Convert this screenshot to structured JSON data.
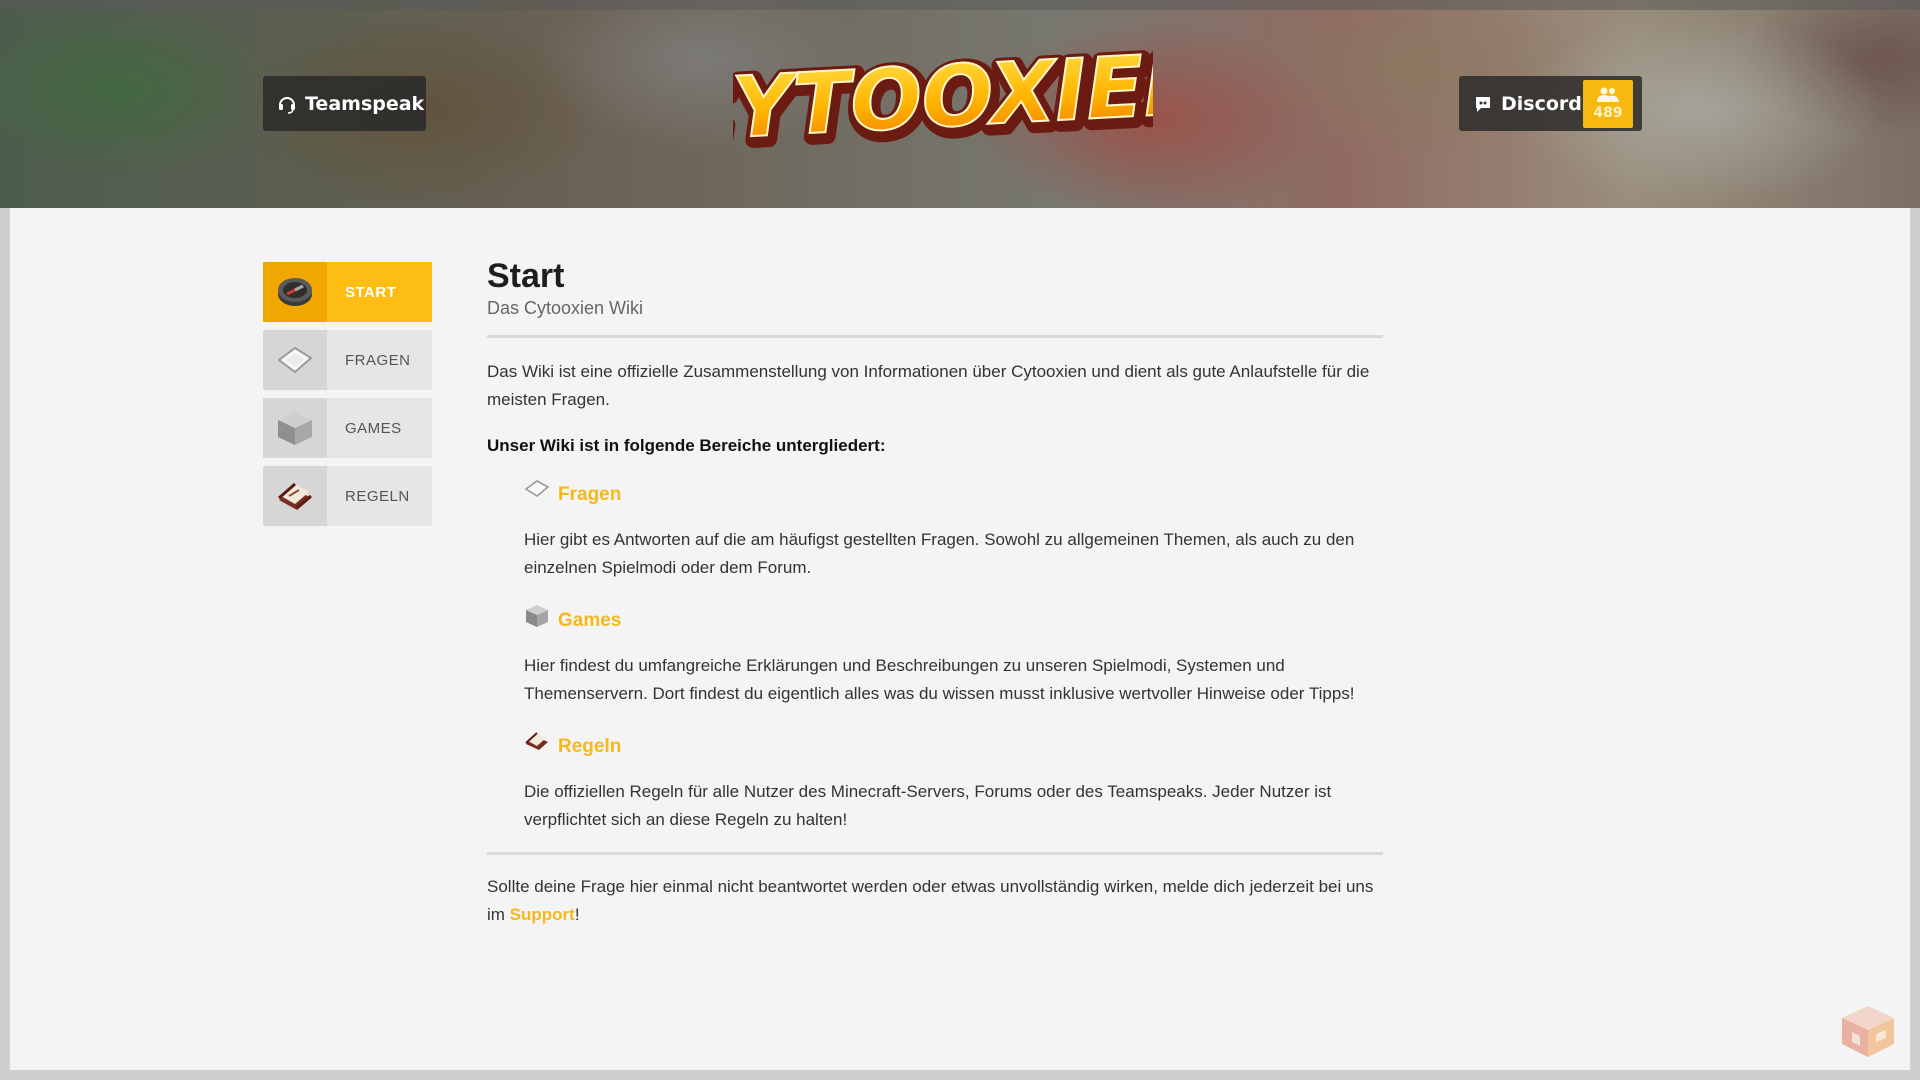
{
  "header": {
    "teamspeak_label": "Teamspeak",
    "discord_label": "Discord",
    "discord_count": "489",
    "logo_text": "CYTOOXIEN"
  },
  "sidebar": {
    "items": [
      {
        "label": "START",
        "icon": "compass-icon",
        "active": true
      },
      {
        "label": "FRAGEN",
        "icon": "paper-icon",
        "active": false
      },
      {
        "label": "GAMES",
        "icon": "stone-block-icon",
        "active": false
      },
      {
        "label": "REGELN",
        "icon": "book-icon",
        "active": false
      }
    ]
  },
  "main": {
    "title": "Start",
    "subtitle": "Das Cytooxien Wiki",
    "intro": "Das Wiki ist eine offizielle Zusammenstellung von Informationen über Cytooxien und dient als gute Anlaufstelle für die meisten Fragen.",
    "sections_heading": "Unser Wiki ist in folgende Bereiche untergliedert:",
    "sections": [
      {
        "title": "Fragen",
        "icon": "paper-icon",
        "text": "Hier gibt es Antworten auf die am häufigst gestellten Fragen. Sowohl zu allgemeinen Themen, als auch zu den einzelnen Spielmodi oder dem Forum."
      },
      {
        "title": "Games",
        "icon": "stone-block-icon",
        "text": "Hier findest du umfangreiche Erklärungen und Beschreibungen zu unseren Spielmodi, Systemen und Themenservern. Dort findest du eigentlich alles was du wissen musst inklusive wertvoller Hinweise oder Tipps!"
      },
      {
        "title": "Regeln",
        "icon": "book-icon",
        "text": "Die offiziellen Regeln für alle Nutzer des Minecraft-Servers, Forums oder des Teamspeaks. Jeder Nutzer ist verpflichtet sich an diese Regeln zu halten!"
      }
    ],
    "footer_text_before": "Sollte deine Frage hier einmal nicht beantwortet werden oder etwas unvollständig wirken, melde dich jederzeit bei uns im ",
    "footer_link": "Support",
    "footer_text_after": "!"
  },
  "colors": {
    "accent": "#fdbd12",
    "link": "#f6b81a",
    "panel_bg": "#f4f4f4"
  }
}
